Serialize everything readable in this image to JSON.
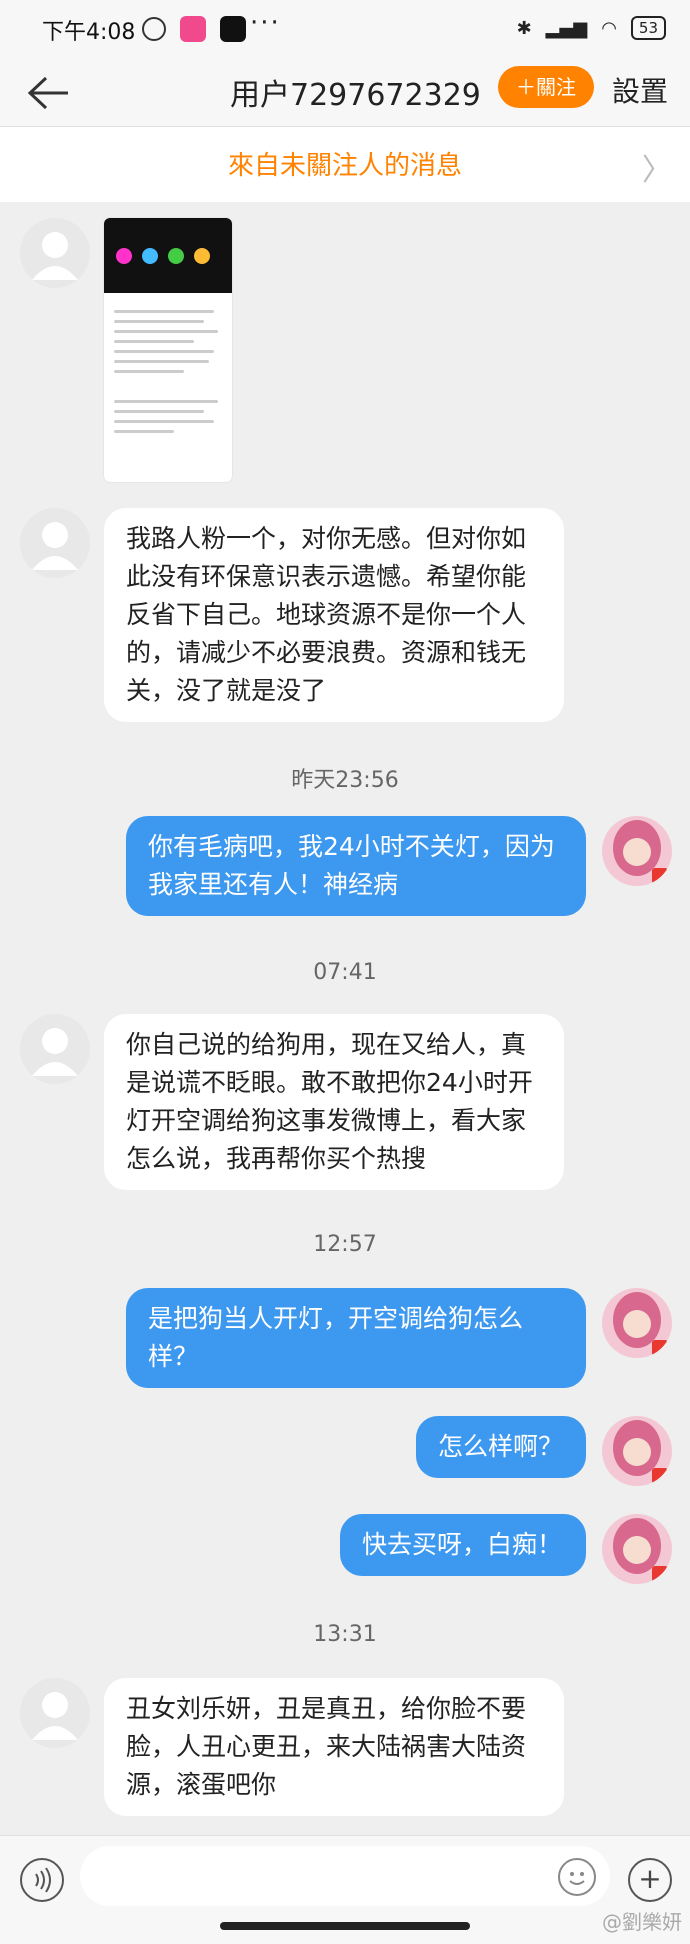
{
  "status_bar": {
    "time": "下午4:08",
    "battery": "53"
  },
  "nav": {
    "title": "用户7297672329",
    "follow_label": "＋關注",
    "settings_label": "設置"
  },
  "banner": {
    "text": "來自未關注人的消息"
  },
  "messages": [
    {
      "text": "我路人粉一个，对你无感。但对你如此没有环保意识表示遗憾。希望你能反省下自己。地球资源不是你一个人的，请减少不必要浪费。资源和钱无关，没了就是没了"
    },
    {
      "text": "你有毛病吧，我24小时不关灯，因为我家里还有人！神经病"
    },
    {
      "text": "你自己说的给狗用，现在又给人，真是说谎不眨眼。敢不敢把你24小时开灯开空调给狗这事发微博上，看大家怎么说，我再帮你买个热搜"
    },
    {
      "text": "是把狗当人开灯，开空调给狗怎么样？"
    },
    {
      "text": "怎么样啊？"
    },
    {
      "text": "快去买呀，白痴！"
    },
    {
      "text": "丑女刘乐妍，丑是真丑，给你脸不要脸，人丑心更丑，来大陆祸害大陆资源，滚蛋吧你"
    }
  ],
  "timestamps": [
    "昨天23:56",
    "07:41",
    "12:57",
    "13:31"
  ],
  "watermark": "@劉樂妍",
  "colors": {
    "accent": "#ff8200",
    "outgoing_bubble": "#3d98f0"
  }
}
